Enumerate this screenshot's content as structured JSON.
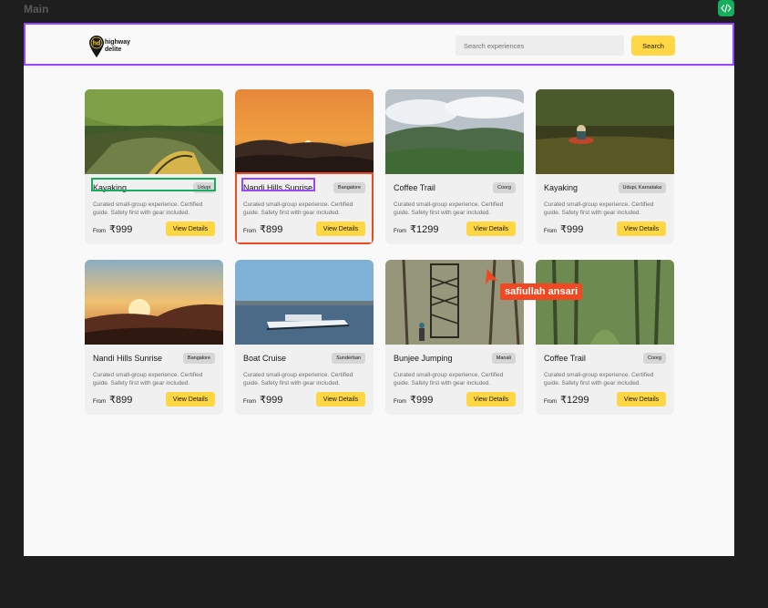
{
  "frame": {
    "label": "Main"
  },
  "header": {
    "logo_line1": "highway",
    "logo_line2": "delite",
    "logo_mark": "hd",
    "search_placeholder": "Search experiences",
    "search_label": "Search"
  },
  "colors": {
    "accent": "#ffd643",
    "selection_purple": "#9747ff",
    "selection_green": "#14ae5c",
    "selection_red": "#f24822"
  },
  "cards": [
    {
      "title": "Kayaking",
      "tag": "Udupi",
      "desc": "Curated small-group experience. Certified guide. Safety first with gear included.",
      "from": "From",
      "price": "₹999",
      "button": "View Details",
      "image": "river-mangrove-kayak"
    },
    {
      "title": "Nandi Hills Sunrise",
      "tag": "Bangalore",
      "desc": "Curated small-group experience. Certified guide. Safety first with gear included.",
      "from": "From",
      "price": "₹899",
      "button": "View Details",
      "image": "orange-sunrise-hills"
    },
    {
      "title": "Coffee Trail",
      "tag": "Coorg",
      "desc": "Curated small-group experience. Certified guide. Safety first with gear included.",
      "from": "From",
      "price": "₹1299",
      "button": "View Details",
      "image": "misty-green-hills"
    },
    {
      "title": "Kayaking",
      "tag": "Udupi, Karnataka",
      "desc": "Curated small-group experience. Certified guide. Safety first with gear included.",
      "from": "From",
      "price": "₹999",
      "button": "View Details",
      "image": "forest-river-kayaker"
    },
    {
      "title": "Nandi Hills Sunrise",
      "tag": "Bangalore",
      "desc": "Curated small-group experience. Certified guide. Safety first with gear included.",
      "from": "From",
      "price": "₹899",
      "button": "View Details",
      "image": "sunset-over-hills"
    },
    {
      "title": "Boat Cruise",
      "tag": "Sunderban",
      "desc": "Curated small-group experience. Certified guide. Safety first with gear included.",
      "from": "From",
      "price": "₹999",
      "button": "View Details",
      "image": "ferry-on-water"
    },
    {
      "title": "Bunjee Jumping",
      "tag": "Manali",
      "desc": "Curated small-group experience. Certified guide. Safety first with gear included.",
      "from": "From",
      "price": "₹999",
      "button": "View Details",
      "image": "spiral-stair-tower-forest"
    },
    {
      "title": "Coffee Trail",
      "tag": "Coorg",
      "desc": "Curated small-group experience. Certified guide. Safety first with gear included.",
      "from": "From",
      "price": "₹1299",
      "button": "View Details",
      "image": "green-forest-path"
    }
  ],
  "collaborator": {
    "name": "safiullah ansari"
  }
}
